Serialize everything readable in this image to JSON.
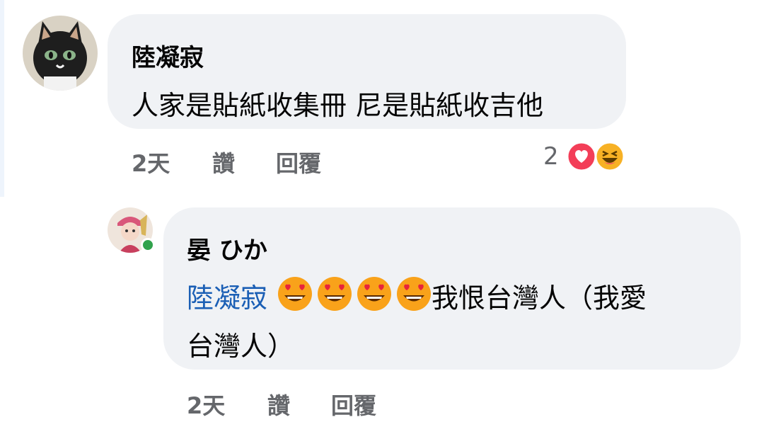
{
  "comments": [
    {
      "author": "陸凝寂",
      "text": "人家是貼紙收集冊 尼是貼紙收吉他",
      "time": "2天",
      "like_label": "讚",
      "reply_label": "回覆",
      "reaction_count": "2",
      "reactions": [
        "love-reaction-icon",
        "haha-reaction-icon"
      ]
    }
  ],
  "replies": [
    {
      "author": "晏 ひか",
      "mention": "陸凝寂",
      "emojis": [
        "heart-eyes-emoji-icon",
        "heart-eyes-emoji-icon",
        "heart-eyes-emoji-icon",
        "heart-eyes-emoji-icon"
      ],
      "text_line1": "我恨台灣人（我愛",
      "text_line2": "台灣人）",
      "time": "2天",
      "like_label": "讚",
      "reply_label": "回覆",
      "online": true
    }
  ],
  "colors": {
    "bubble": "#f0f2f5",
    "mention": "#1b5fb5",
    "meta": "#65676b",
    "online": "#31a24c",
    "love": "#f33e58",
    "haha": "#f7b125"
  }
}
